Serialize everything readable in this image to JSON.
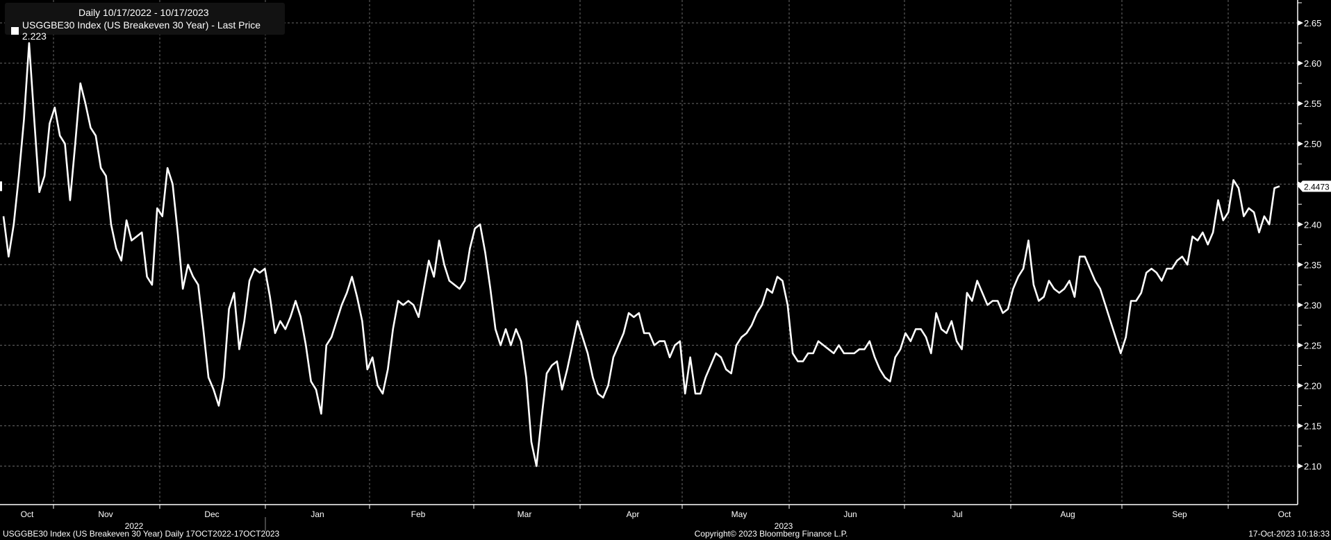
{
  "legend": {
    "period": "Daily 10/17/2022 - 10/17/2023",
    "series_label": "USGGBE30 Index (US Breakeven 30 Year) - Last Price 2.223"
  },
  "footer": {
    "left": "USGGBE30 Index (US Breakeven 30 Year)  Daily 17OCT2022-17OCT2023",
    "center": "Copyright© 2023 Bloomberg Finance L.P.",
    "right": "17-Oct-2023 10:18:33"
  },
  "colors": {
    "background": "#000000",
    "line": "#ffffff",
    "grid": "#6a6a6a"
  },
  "chart_data": {
    "type": "line",
    "title": "USGGBE30 Index (US Breakeven 30 Year)",
    "x_range": [
      "10/17/2022",
      "10/17/2023"
    ],
    "ylim": [
      2.05,
      2.68
    ],
    "yticks": [
      "2.10",
      "2.15",
      "2.20",
      "2.25",
      "2.30",
      "2.35",
      "2.40",
      "2.45",
      "2.50",
      "2.55",
      "2.60",
      "2.65"
    ],
    "months": [
      "Oct",
      "Nov",
      "Dec",
      "Jan",
      "Feb",
      "Mar",
      "Apr",
      "May",
      "Jun",
      "Jul",
      "Aug",
      "Sep",
      "Oct"
    ],
    "years": [
      "2022",
      "2023"
    ],
    "last_value_label": "2.4473",
    "grid": true,
    "series": [
      {
        "name": "USGGBE30 Index",
        "values": [
          2.41,
          2.36,
          2.4,
          2.46,
          2.53,
          2.625,
          2.53,
          2.44,
          2.46,
          2.525,
          2.545,
          2.51,
          2.5,
          2.43,
          2.5,
          2.575,
          2.55,
          2.52,
          2.51,
          2.47,
          2.46,
          2.4,
          2.37,
          2.355,
          2.405,
          2.38,
          2.385,
          2.39,
          2.335,
          2.325,
          2.42,
          2.41,
          2.47,
          2.45,
          2.39,
          2.32,
          2.35,
          2.335,
          2.325,
          2.27,
          2.21,
          2.195,
          2.175,
          2.21,
          2.295,
          2.315,
          2.245,
          2.28,
          2.33,
          2.345,
          2.34,
          2.345,
          2.31,
          2.265,
          2.28,
          2.27,
          2.285,
          2.305,
          2.285,
          2.25,
          2.205,
          2.195,
          2.165,
          2.25,
          2.26,
          2.28,
          2.3,
          2.315,
          2.335,
          2.31,
          2.28,
          2.22,
          2.235,
          2.2,
          2.19,
          2.22,
          2.27,
          2.305,
          2.3,
          2.305,
          2.3,
          2.285,
          2.32,
          2.355,
          2.335,
          2.38,
          2.35,
          2.33,
          2.325,
          2.32,
          2.33,
          2.37,
          2.395,
          2.4,
          2.365,
          2.32,
          2.27,
          2.25,
          2.27,
          2.25,
          2.27,
          2.255,
          2.21,
          2.13,
          2.1,
          2.16,
          2.215,
          2.225,
          2.23,
          2.195,
          2.22,
          2.25,
          2.28,
          2.26,
          2.24,
          2.21,
          2.19,
          2.185,
          2.2,
          2.235,
          2.25,
          2.265,
          2.29,
          2.285,
          2.29,
          2.265,
          2.265,
          2.25,
          2.255,
          2.255,
          2.235,
          2.25,
          2.255,
          2.19,
          2.235,
          2.19,
          2.19,
          2.21,
          2.225,
          2.24,
          2.235,
          2.22,
          2.215,
          2.25,
          2.26,
          2.265,
          2.275,
          2.29,
          2.3,
          2.32,
          2.315,
          2.335,
          2.33,
          2.3,
          2.24,
          2.23,
          2.23,
          2.24,
          2.24,
          2.255,
          2.25,
          2.245,
          2.24,
          2.25,
          2.24,
          2.24,
          2.24,
          2.245,
          2.245,
          2.255,
          2.235,
          2.22,
          2.21,
          2.205,
          2.235,
          2.245,
          2.265,
          2.255,
          2.27,
          2.27,
          2.26,
          2.24,
          2.29,
          2.27,
          2.265,
          2.28,
          2.255,
          2.245,
          2.315,
          2.305,
          2.33,
          2.315,
          2.3,
          2.305,
          2.305,
          2.29,
          2.295,
          2.32,
          2.335,
          2.345,
          2.38,
          2.325,
          2.305,
          2.31,
          2.33,
          2.32,
          2.315,
          2.32,
          2.33,
          2.31,
          2.36,
          2.36,
          2.345,
          2.33,
          2.32,
          2.3,
          2.28,
          2.26,
          2.24,
          2.26,
          2.305,
          2.305,
          2.315,
          2.34,
          2.345,
          2.34,
          2.33,
          2.345,
          2.345,
          2.355,
          2.36,
          2.35,
          2.385,
          2.38,
          2.39,
          2.375,
          2.39,
          2.43,
          2.405,
          2.415,
          2.455,
          2.445,
          2.41,
          2.42,
          2.415,
          2.39,
          2.41,
          2.4,
          2.445,
          2.4473
        ]
      }
    ]
  }
}
